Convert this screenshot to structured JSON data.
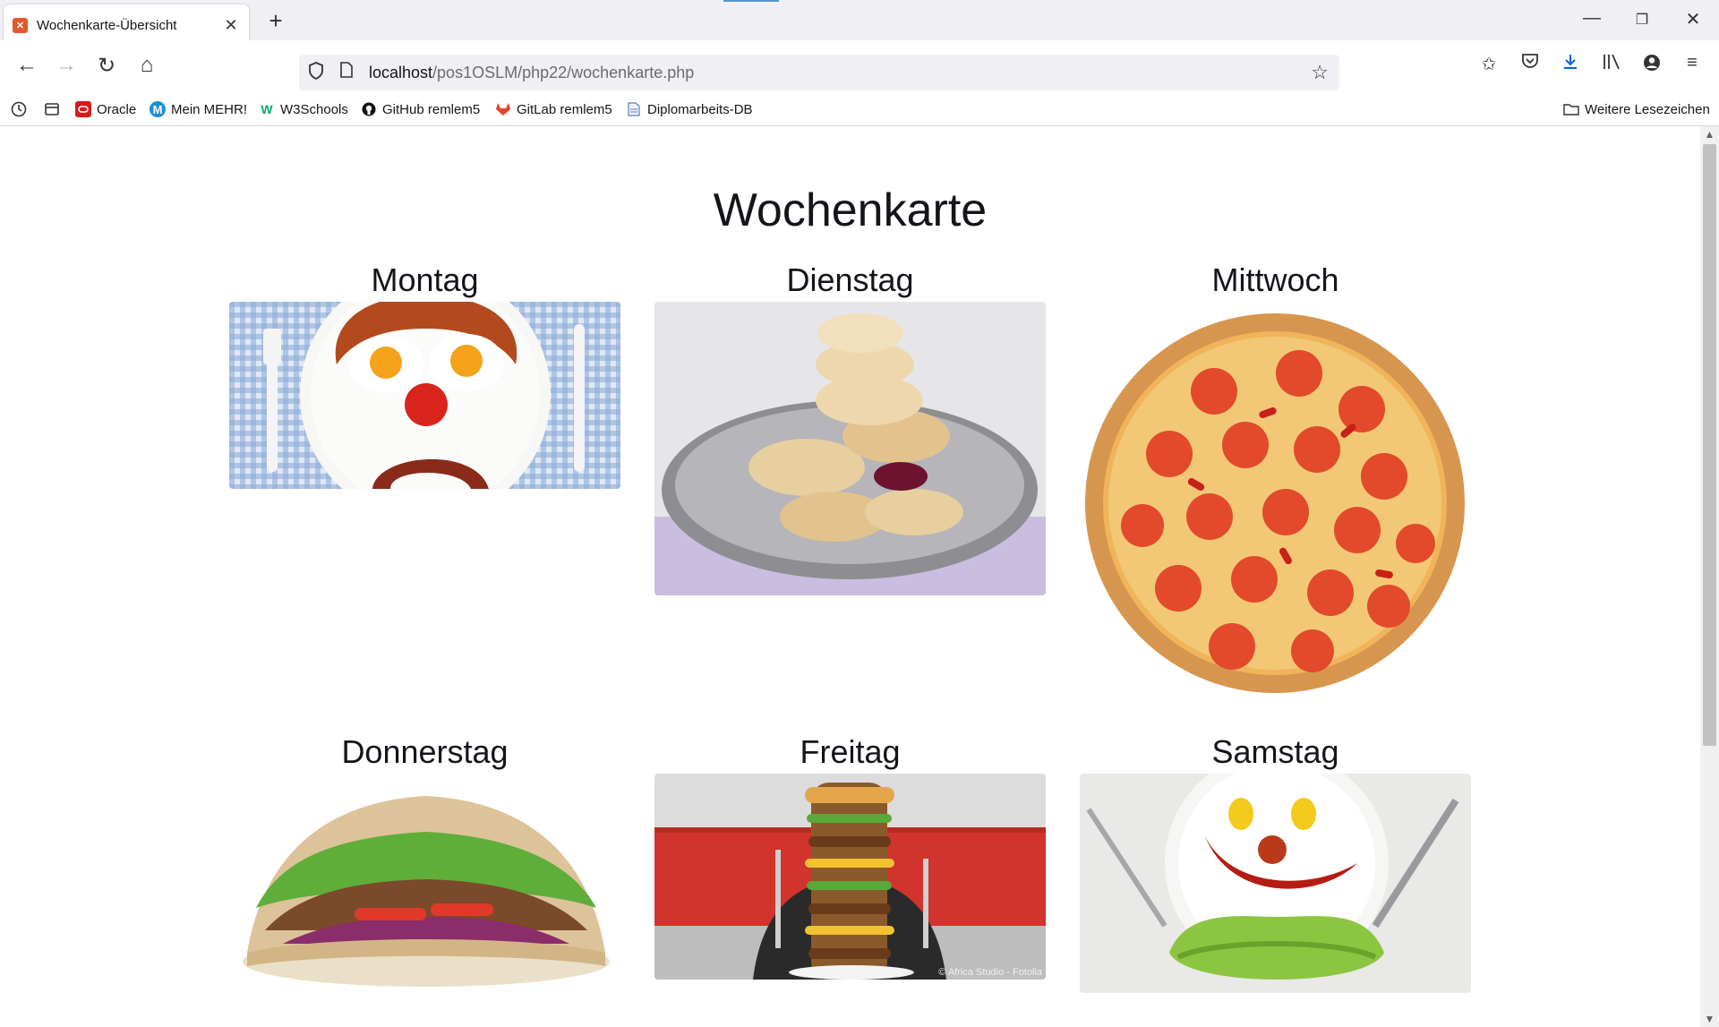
{
  "browser": {
    "tab_title": "Wochenkarte-Übersicht",
    "url_host": "localhost",
    "url_path": "/pos1OSLM/php22/wochenkarte.php"
  },
  "bookmarks": {
    "items": [
      {
        "label": "Oracle",
        "color": "#d61b1b"
      },
      {
        "label": "Mein MEHR!",
        "color": "#1a8fd6"
      },
      {
        "label": "W3Schools",
        "color": "#04aa6d"
      },
      {
        "label": "GitHub remlem5",
        "color": "#111111"
      },
      {
        "label": "GitLab remlem5",
        "color": "#e24329"
      },
      {
        "label": "Diplomarbeits-DB",
        "color": "#5b7fb0"
      }
    ],
    "more_label": "Weitere Lesezeichen"
  },
  "page": {
    "title": "Wochenkarte",
    "days": [
      {
        "name": "Montag",
        "image": "breakfast-face-plate"
      },
      {
        "name": "Dienstag",
        "image": "pancakes-with-jam"
      },
      {
        "name": "Mittwoch",
        "image": "pepperoni-pizza"
      },
      {
        "name": "Donnerstag",
        "image": "doner-kebab"
      },
      {
        "name": "Freitag",
        "image": "tall-burger-stack"
      },
      {
        "name": "Samstag",
        "image": "vegetable-smiley-plate"
      }
    ],
    "photo_credit": "© Africa Studio - Fotolia"
  }
}
